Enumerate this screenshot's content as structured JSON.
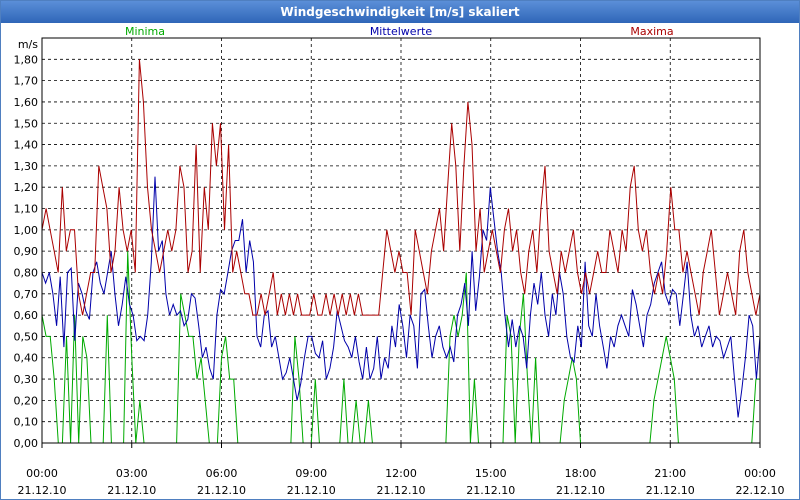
{
  "window": {
    "title": "Windgeschwindigkeit [m/s] skaliert"
  },
  "chart_data": {
    "type": "line",
    "title": "Windgeschwindigkeit [m/s] skaliert",
    "ylabel": "m/s",
    "ylim": [
      0,
      1.9
    ],
    "xlim_hours": [
      0,
      24
    ],
    "grid": true,
    "legend_placement": "top",
    "yticks": [
      "0,00",
      "0,10",
      "0,20",
      "0,30",
      "0,40",
      "0,50",
      "0,60",
      "0,70",
      "0,80",
      "0,90",
      "1,00",
      "1,10",
      "1,20",
      "1,30",
      "1,40",
      "1,50",
      "1,60",
      "1,70",
      "1,80"
    ],
    "xticks": [
      {
        "time": "00:00",
        "date": "21.12.10"
      },
      {
        "time": "03:00",
        "date": "21.12.10"
      },
      {
        "time": "06:00",
        "date": "21.12.10"
      },
      {
        "time": "09:00",
        "date": "21.12.10"
      },
      {
        "time": "12:00",
        "date": "21.12.10"
      },
      {
        "time": "15:00",
        "date": "21.12.10"
      },
      {
        "time": "18:00",
        "date": "21.12.10"
      },
      {
        "time": "21:00",
        "date": "21.12.10"
      },
      {
        "time": "00:00",
        "date": "22.12.10"
      }
    ],
    "series": [
      {
        "name": "Minima",
        "color": "#00aa00",
        "values": [
          0.6,
          0.5,
          0.5,
          0.3,
          0.0,
          0.0,
          0.5,
          0.0,
          0.6,
          0.0,
          0.5,
          0.4,
          0.0,
          0.0,
          0.0,
          0.0,
          0.6,
          0.0,
          0.0,
          0.0,
          0.0,
          0.9,
          0.4,
          0.0,
          0.2,
          0.0,
          0.0,
          0.0,
          0.0,
          0.0,
          0.0,
          0.0,
          0.0,
          0.0,
          0.7,
          0.6,
          0.5,
          0.5,
          0.3,
          0.4,
          0.2,
          0.0,
          0.0,
          0.0,
          0.4,
          0.5,
          0.3,
          0.3,
          0.0,
          0.0,
          0.0,
          0.0,
          0.0,
          0.0,
          0.0,
          0.0,
          0.0,
          0.0,
          0.0,
          0.0,
          0.0,
          0.0,
          0.5,
          0.3,
          0.0,
          0.0,
          0.0,
          0.3,
          0.0,
          0.0,
          0.0,
          0.0,
          0.0,
          0.0,
          0.3,
          0.0,
          0.0,
          0.2,
          0.0,
          0.0,
          0.2,
          0.0,
          0.0,
          0.0,
          0.0,
          0.0,
          0.0,
          0.0,
          0.0,
          0.0,
          0.0,
          0.0,
          0.0,
          0.0,
          0.0,
          0.0,
          0.0,
          0.0,
          0.0,
          0.0,
          0.5,
          0.6,
          0.5,
          0.6,
          0.8,
          0.0,
          0.3,
          0.0,
          0.0,
          0.0,
          0.0,
          0.0,
          0.0,
          0.0,
          0.6,
          0.5,
          0.0,
          0.5,
          0.7,
          0.3,
          0.0,
          0.4,
          0.0,
          0.0,
          0.0,
          0.0,
          0.0,
          0.0,
          0.2,
          0.3,
          0.4,
          0.3,
          0.0,
          0.0,
          0.0,
          0.0,
          0.0,
          0.0,
          0.0,
          0.0,
          0.0,
          0.0,
          0.0,
          0.0,
          0.0,
          0.0,
          0.0,
          0.0,
          0.0,
          0.0,
          0.2,
          0.3,
          0.4,
          0.5,
          0.4,
          0.3,
          0.0,
          0.0,
          0.0,
          0.0,
          0.0,
          0.0,
          0.0,
          0.0,
          0.0,
          0.0,
          0.0,
          0.0,
          0.0,
          0.0,
          0.0,
          0.0,
          0.0,
          0.0,
          0.0,
          0.3,
          0.3
        ]
      },
      {
        "name": "Mittelwerte",
        "color": "#0000aa",
        "values": [
          0.8,
          0.75,
          0.8,
          0.7,
          0.55,
          0.78,
          0.45,
          0.8,
          0.82,
          0.48,
          0.75,
          0.7,
          0.62,
          0.58,
          0.8,
          0.85,
          0.75,
          0.7,
          0.8,
          0.9,
          0.7,
          0.55,
          0.65,
          0.78,
          0.65,
          0.6,
          0.48,
          0.5,
          0.48,
          0.6,
          0.85,
          1.25,
          0.9,
          0.95,
          0.7,
          0.6,
          0.65,
          0.6,
          0.62,
          0.55,
          0.58,
          0.7,
          0.68,
          0.55,
          0.4,
          0.45,
          0.35,
          0.3,
          0.6,
          0.72,
          0.7,
          0.8,
          0.9,
          0.95,
          0.95,
          1.05,
          0.8,
          0.95,
          0.85,
          0.5,
          0.45,
          0.6,
          0.62,
          0.45,
          0.5,
          0.4,
          0.3,
          0.33,
          0.4,
          0.3,
          0.2,
          0.28,
          0.4,
          0.5,
          0.5,
          0.42,
          0.4,
          0.48,
          0.3,
          0.35,
          0.45,
          0.62,
          0.55,
          0.48,
          0.45,
          0.4,
          0.5,
          0.38,
          0.3,
          0.45,
          0.3,
          0.35,
          0.5,
          0.3,
          0.4,
          0.35,
          0.55,
          0.45,
          0.65,
          0.55,
          0.4,
          0.6,
          0.55,
          0.35,
          0.7,
          0.72,
          0.55,
          0.4,
          0.5,
          0.55,
          0.45,
          0.4,
          0.45,
          0.38,
          0.6,
          0.65,
          0.75,
          0.55,
          0.9,
          0.62,
          0.78,
          1.0,
          0.95,
          1.2,
          1.05,
          0.9,
          0.8,
          0.6,
          0.45,
          0.58,
          0.45,
          0.55,
          0.5,
          0.35,
          0.6,
          0.75,
          0.65,
          0.8,
          0.6,
          0.5,
          0.7,
          0.6,
          0.8,
          0.7,
          0.5,
          0.4,
          0.38,
          0.55,
          0.45,
          0.85,
          0.55,
          0.5,
          0.7,
          0.55,
          0.45,
          0.35,
          0.5,
          0.45,
          0.55,
          0.6,
          0.55,
          0.5,
          0.72,
          0.65,
          0.55,
          0.45,
          0.6,
          0.65,
          0.75,
          0.8,
          0.85,
          0.7,
          0.65,
          0.72,
          0.7,
          0.55,
          0.7,
          0.85,
          0.6,
          0.5,
          0.55,
          0.45,
          0.5,
          0.55,
          0.45,
          0.5,
          0.48,
          0.4,
          0.45,
          0.5,
          0.3,
          0.12,
          0.25,
          0.4,
          0.6,
          0.55,
          0.3,
          0.5
        ]
      },
      {
        "name": "Maxima",
        "color": "#aa0000",
        "values": [
          1.0,
          1.1,
          1.0,
          0.9,
          0.8,
          1.2,
          0.9,
          1.0,
          1.0,
          0.7,
          0.6,
          0.7,
          0.8,
          0.8,
          1.3,
          1.2,
          1.1,
          0.8,
          0.9,
          1.2,
          1.0,
          0.9,
          1.0,
          0.8,
          1.8,
          1.6,
          1.2,
          1.0,
          0.9,
          0.8,
          0.9,
          1.0,
          0.9,
          1.0,
          1.3,
          1.2,
          0.8,
          0.9,
          1.4,
          0.8,
          1.2,
          1.0,
          1.5,
          1.3,
          1.5,
          1.0,
          1.4,
          0.8,
          0.9,
          0.8,
          0.7,
          0.7,
          0.6,
          0.6,
          0.7,
          0.6,
          0.7,
          0.8,
          0.6,
          0.7,
          0.6,
          0.7,
          0.6,
          0.7,
          0.6,
          0.6,
          0.6,
          0.7,
          0.6,
          0.6,
          0.7,
          0.6,
          0.7,
          0.6,
          0.7,
          0.6,
          0.7,
          0.6,
          0.7,
          0.6,
          0.6,
          0.6,
          0.6,
          0.6,
          0.8,
          1.0,
          0.9,
          0.8,
          0.9,
          0.8,
          0.8,
          0.6,
          1.0,
          0.9,
          0.8,
          0.7,
          0.9,
          1.0,
          1.1,
          0.9,
          1.2,
          1.5,
          1.3,
          0.9,
          1.3,
          1.6,
          1.4,
          0.9,
          1.1,
          0.8,
          0.9,
          1.0,
          0.9,
          0.8,
          1.0,
          1.1,
          0.9,
          1.0,
          0.8,
          0.7,
          0.9,
          1.0,
          0.8,
          1.1,
          1.3,
          0.9,
          0.8,
          0.7,
          0.9,
          0.8,
          0.9,
          1.0,
          0.8,
          0.7,
          0.8,
          0.7,
          0.8,
          0.9,
          0.8,
          0.8,
          1.0,
          0.9,
          0.8,
          1.0,
          0.9,
          1.2,
          1.3,
          1.0,
          0.9,
          1.0,
          0.8,
          0.7,
          0.8,
          0.7,
          0.9,
          1.2,
          1.0,
          1.0,
          0.8,
          0.9,
          0.8,
          0.7,
          0.6,
          0.8,
          0.9,
          1.0,
          0.8,
          0.6,
          0.7,
          0.8,
          0.7,
          0.6,
          0.9,
          1.0,
          0.8,
          0.7,
          0.6,
          0.7
        ]
      }
    ]
  }
}
